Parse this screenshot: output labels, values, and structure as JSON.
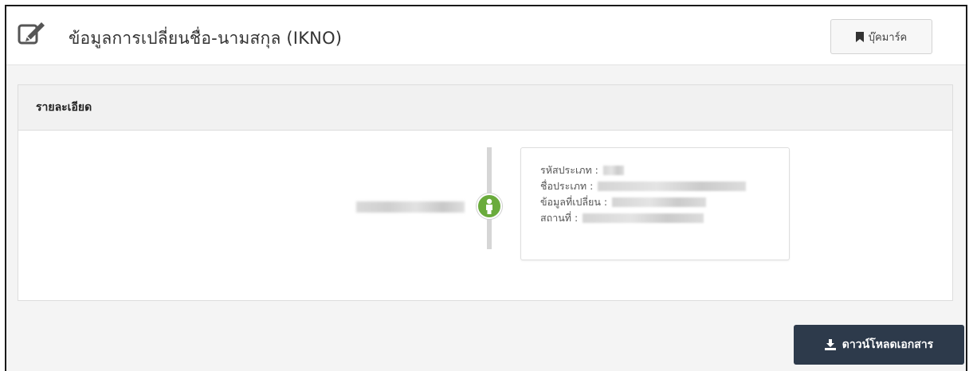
{
  "header": {
    "title": "ข้อมูลการเปลี่ยนชื่อ-นามสกุล (IKNO)",
    "bookmark_label": "บุ๊คมาร์ค",
    "edit_icon": "edit-icon",
    "bookmark_icon": "bookmark-icon"
  },
  "panel": {
    "title": "รายละเอียด"
  },
  "timeline": {
    "marker_icon": "person-icon",
    "marker_color": "#6aab3c",
    "card": {
      "rows": [
        {
          "label": "รหัสประเภท :"
        },
        {
          "label": "ชื่อประเภท :"
        },
        {
          "label": "ข้อมูลที่เปลี่ยน :"
        },
        {
          "label": "สถานที่ :"
        }
      ]
    }
  },
  "actions": {
    "download_label": "ดาวน์โหลดเอกสาร",
    "download_icon": "download-icon",
    "download_color": "#2d3a4b"
  }
}
